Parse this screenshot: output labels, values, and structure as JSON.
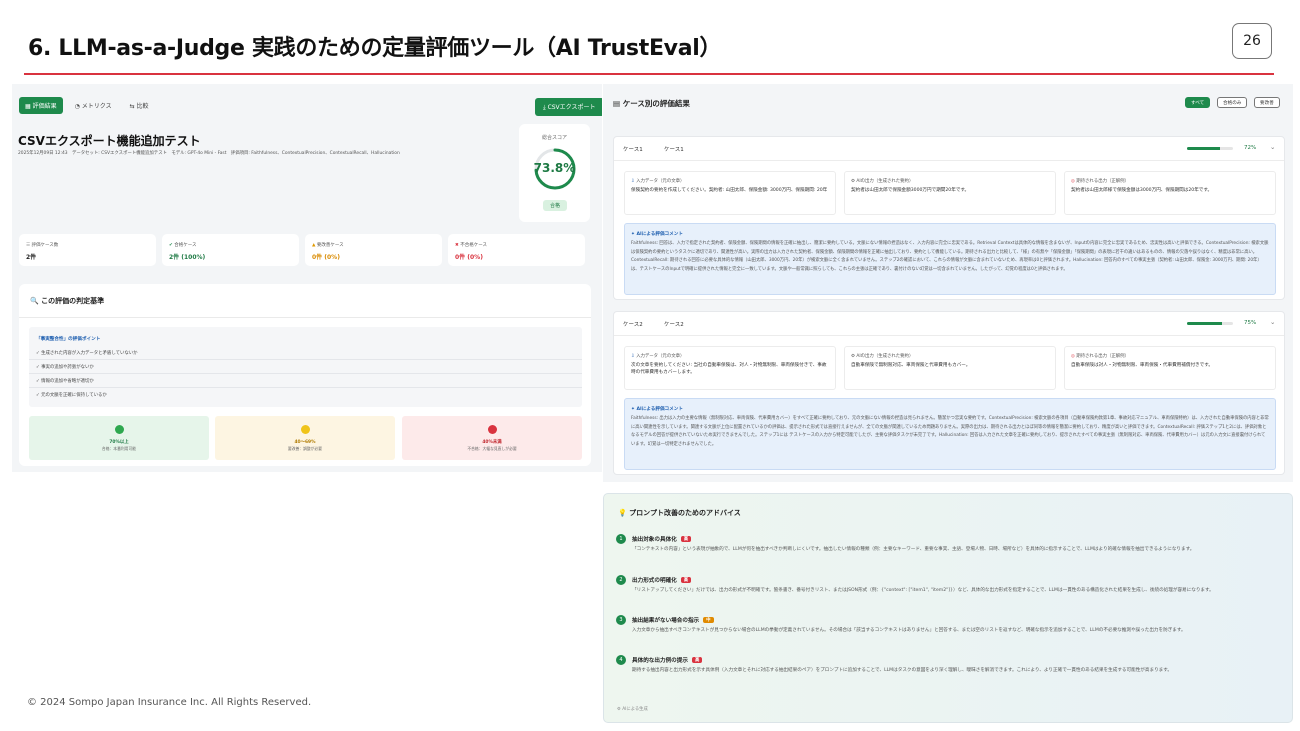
{
  "slide": {
    "title": "6. LLM-as-a-Judge 実践のための定量評価ツール（AI TrustEval）",
    "page_number": "26",
    "footer": "© 2024 Sompo Japan Insurance Inc. All Rights Reserved."
  },
  "left_panel": {
    "tabs": [
      "評価結果",
      "メトリクス",
      "比較"
    ],
    "csv_button": "CSVエクスポート",
    "test_title": "CSVエクスポート機能追加テスト",
    "meta": "2025年12月09日 12:43　データセット: CSVエクスポート機能追加テスト　モデル: GPT-4o Mini - Fast　評価項目: Faithfulness、ContextualPrecision、ContextualRecall、Hallucination",
    "score": {
      "label": "総合スコア",
      "value": "73.8%",
      "fraction": 0.738,
      "badge": "合格"
    },
    "stats": [
      {
        "label": "評価ケース数",
        "value": "2件",
        "color": "#222222"
      },
      {
        "label": "合格ケース",
        "value": "2件 (100%)",
        "color": "#1e7a44"
      },
      {
        "label": "要改善ケース",
        "value": "0件 (0%)",
        "color": "#d98a00"
      },
      {
        "label": "不合格ケース",
        "value": "0件 (0%)",
        "color": "#d9333f"
      }
    ],
    "criteria": {
      "title": "この評価の判定基準",
      "points_title": "「事実整合性」の評価ポイント",
      "points": [
        "✓ 生成された内容が入力データと矛盾していないか",
        "✓ 事実の追加や誇張がないか",
        "✓ 情報の追加や省略が適切か",
        "✓ 元の文脈を正確に保持しているか"
      ],
      "tiers": [
        {
          "label": "70%以上",
          "desc": "合格：本番利用可能",
          "bg": "#e6f5ea",
          "dot": "#2ea84f",
          "color": "#1e7a44"
        },
        {
          "label": "40〜69%",
          "desc": "要改善：調整が必要",
          "bg": "#fdf5e2",
          "dot": "#f0c419",
          "color": "#b07b00"
        },
        {
          "label": "40%未満",
          "desc": "不合格：大幅な見直しが必要",
          "bg": "#fdeaea",
          "dot": "#d9333f",
          "color": "#c0282f"
        }
      ]
    }
  },
  "right_panel": {
    "title": "ケース別の評価結果",
    "filters": [
      "すべて",
      "合格のみ",
      "要改善"
    ],
    "io_labels": [
      "入力データ（元の文章）",
      "AIの出力（生成された要約）",
      "期待される出力（正解例）"
    ],
    "ai_comment_title": "AIによる評価コメント",
    "cases": [
      {
        "no": "ケース1",
        "name": "ケース1",
        "score": 0.72,
        "pct": "72%",
        "input": "保険契約の要約を作成してください。契約者: 山田太郎、保険金額: 3000万円、保険期間: 20年",
        "output": "契約者は山田太郎で保険金額3000万円で期間20年です。",
        "expected": "契約者は山田太郎様で保険金額は3000万円、保険期間は20年です。",
        "comment": "Faithfulness: 回答は、入力で指定された契約者、保険金額、保険期間の情報を正確に抽出し、簡潔に要約している。文脈にない情報の捏造はなく、入力内容に完全に忠実である。Retrieval Contextは具体的な情報を含まないが、Inputの内容に完全に忠実であるため、忠実性は高いと評価できる。ContextualPrecision: 検索文脈は保険契約の要約というタスクに適切であり、関連性が高い。実際の出力は入力された契約者、保険金額、保険期間の情報を正確に抽出しており、要約として機能している。期待される出力と比較して、「様」の有無や「保険金額」「保険期間」の表現に若干の違いはあるものの、情報の欠落や誤りはなく、精度は非常に高い。ContextualRecall: 期待される回答に必要な具体的な情報（山田太郎、3000万円、20年）が検索文脈に全く含まれていません。ステップ2の確認において、これらの情報が文脈に含まれていないため、再現率は0と評価されます。Hallucination: 回答内のすべての事実主張（契約者: 山田太郎、保険金: 3000万円、期間: 20年）は、テストケースのInputで明確に提供された情報と完全に一致しています。文脈や一般常識に照らしても、これらの主張は正確であり、裏付けのない幻覚は一切含まれていません。したがって、幻覚の程度は0と評価されます。"
      },
      {
        "no": "ケース2",
        "name": "ケース2",
        "score": 0.75,
        "pct": "75%",
        "input": "次の文章を要約してください: 当社の自動車保険は、対人・対物無制限、車両保険付きで、事故時の代車費用もカバーします。",
        "output": "自動車保険で無制限対応、車両保険と代車費用もカバー。",
        "expected": "自動車保険は対人・対物無制限、車両保険・代車費用補償付きです。",
        "comment": "Faithfulness: 出力は入力の主要な情報（無制限対応、車両保険、代車費用カバー）をすべて正確に要約しており、元の文脈にない情報の捏造は見られません。簡潔かつ忠実な要約です。ContextualPrecision: 検索文脈の各項目（自動車保険約款第1章、事故対応マニュアル、車両保険特約）は、入力された自動車保険の内容と非常に高い関連性を示しています。関連する文脈が上位に配置されているかの評価は、提示された形式では直接行えませんが、全ての文脈が関連しているため問題ありません。実際の出力は、期待される出力とほぼ同等の情報を簡潔に要約しており、精度が高いと評価できます。ContextualRecall: 評価ステップ1と2には、評価対象となるモデルの回答が提供されていないため実行できませんでした。ステップ1には テストケースの入力から特定可能でしたが、主要な評価タスクが未完了です。Hallucination: 回答は入力された文章を正確に要約しており、提示されたすべての事実主張（無制限対応、車両保険、代車費用カバー）は元の入力文に直接裏付けられています。幻覚は一切特定されませんでした。"
      }
    ]
  },
  "advice": {
    "title": "プロンプト改善のためのアドバイス",
    "items": [
      {
        "num": "1",
        "head": "抽出対象の具体化",
        "tag": "高",
        "tag_color": "#d9333f",
        "text": "「コンテキストの内容」という表現が抽象的で、LLMが何を抽出すべきか判断しにくいです。抽出したい情報の種類（例：主要なキーワード、重要な事実、主語、登場人物、日時、場所など）を具体的に指示することで、LLMはより的確な情報を抽出できるようになります。"
      },
      {
        "num": "2",
        "head": "出力形式の明確化",
        "tag": "高",
        "tag_color": "#d9333f",
        "text": "「リストアップしてください」だけでは、出力の形式が不明確です。箇条書き、番号付きリスト、またはJSON形式（例：{\"context\": [\"item1\", \"item2\"]}）など、具体的な出力形式を指定することで、LLMは一貫性のある構造化された結果を生成し、後続の処理が容易になります。"
      },
      {
        "num": "3",
        "head": "抽出結果がない場合の指示",
        "tag": "中",
        "tag_color": "#e08a00",
        "text": "入力文章から抽出すべきコンテキストが見つからない場合のLLMの挙動が定義されていません。その場合は「該当するコンテキストはありません」と回答する、または空のリストを返すなど、明確な指示を追加することで、LLMの不必要な推測や誤った出力を防ぎます。"
      },
      {
        "num": "4",
        "head": "具体的な出力例の提示",
        "tag": "高",
        "tag_color": "#d9333f",
        "text": "期待する抽出内容と出力形式を示す具体例（入力文章とそれに対応する抽出結果のペア）をプロンプトに追加することで、LLMはタスクの意図をより深く理解し、曖昧さを解消できます。これにより、より正確で一貫性のある結果を生成する可能性が高まります。"
      }
    ],
    "footer": "AIによる生成"
  }
}
